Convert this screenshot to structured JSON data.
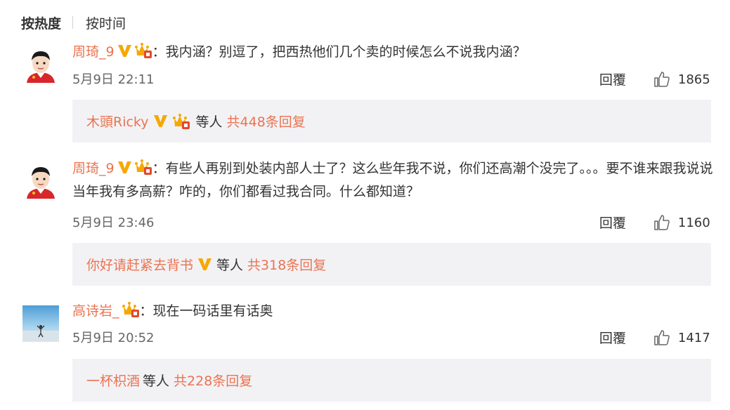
{
  "tabs": {
    "hot": "按热度",
    "time": "按时间"
  },
  "colors": {
    "accent": "#eb7350",
    "badge": "#f6a802",
    "subbox_bg": "#f2f2f5"
  },
  "comments": [
    {
      "username": "周琦_9",
      "colon": "：",
      "text": "我内涵？别逗了，把西热他们几个卖的时候怎么不说我内涵？",
      "date": "5月9日 22:11",
      "reply_label": "回覆",
      "likes": "1865",
      "sub_user": "木頭Ricky",
      "sub_etal": "等人",
      "sub_count": "共448条回复"
    },
    {
      "username": "周琦_9",
      "colon": "：",
      "text": "有些人再别到处装内部人士了？这么些年我不说，你们还高潮个没完了。。。要不谁来跟我说说当年我有多高薪？咋的，你们都看过我合同。什么都知道？",
      "date": "5月9日 23:46",
      "reply_label": "回覆",
      "likes": "1160",
      "sub_user": "你好请赶紧去背书",
      "sub_etal": "等人",
      "sub_count": "共318条回复"
    },
    {
      "username": "高诗岩_",
      "colon": "：",
      "text": "现在一码话里有话奥",
      "date": "5月9日 20:52",
      "reply_label": "回覆",
      "likes": "1417",
      "sub_user": "一杯枳酒",
      "sub_etal": "等人",
      "sub_count": "共228条回复"
    }
  ]
}
